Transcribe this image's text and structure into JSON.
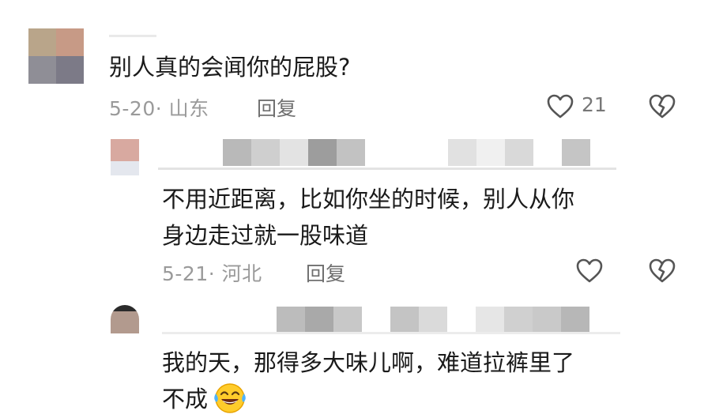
{
  "comments": [
    {
      "text": "别人真的会闻你的屁股?",
      "date_location": "5-20· 山东",
      "reply_label": "回复",
      "like_count": "21",
      "like_icon": "heart-outline-icon",
      "dislike_icon": "broken-heart-icon"
    },
    {
      "text_line1": "不用近距离，比如你坐的时候，别人从你",
      "text_line2": "身边走过就一股味道",
      "date_location": "5-21· 河北",
      "reply_label": "回复",
      "like_icon": "heart-outline-icon",
      "dislike_icon": "broken-heart-icon"
    },
    {
      "text_line1": "我的天，那得多大味儿啊，难道拉裤里了",
      "text_line2": "不成",
      "emoji": "😂",
      "emoji_icon": "laughing-tears-emoji-icon"
    }
  ],
  "colors": {
    "meta_text": "#9a9a9a",
    "reply_text": "#6f6f6f",
    "body_text": "#1a1a1a",
    "icon_stroke": "#555555"
  }
}
